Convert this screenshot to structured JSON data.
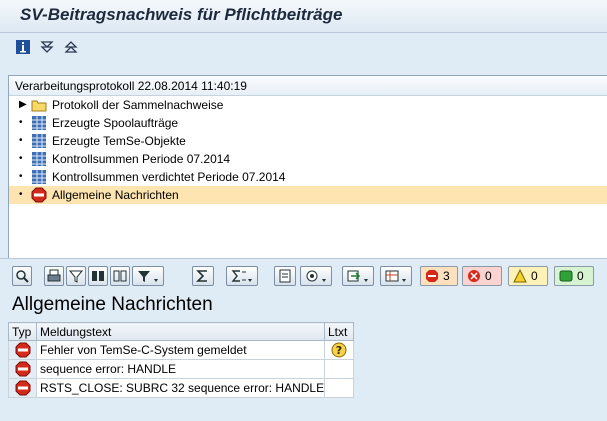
{
  "window": {
    "title": "SV-Beitragsnachweis für Pflichtbeiträge"
  },
  "app_toolbar": {
    "icons": [
      "info-icon",
      "expand-all-icon",
      "collapse-all-icon"
    ]
  },
  "tree": {
    "header": "Verarbeitungsprotokoll 22.08.2014 11:40:19",
    "items": [
      {
        "label": "Protokoll der Sammelnachweise",
        "icon": "folder-icon",
        "expander": "▶"
      },
      {
        "label": "Erzeugte Spoolaufträge",
        "icon": "table-icon",
        "expander": "•"
      },
      {
        "label": "Erzeugte TemSe-Objekte",
        "icon": "table-icon",
        "expander": "•"
      },
      {
        "label": "Kontrollsummen Periode 07.2014",
        "icon": "table-icon",
        "expander": "•"
      },
      {
        "label": "Kontrollsummen verdichtet Periode 07.2014",
        "icon": "table-icon",
        "expander": "•"
      },
      {
        "label": "Allgemeine Nachrichten",
        "icon": "stop-icon",
        "expander": "•",
        "selected": true
      }
    ]
  },
  "alv_toolbar": {
    "counters": {
      "stop": "3",
      "error": "0",
      "warning": "0",
      "success": "0"
    }
  },
  "grid": {
    "title": "Allgemeine Nachrichten",
    "columns": [
      "Typ",
      "Meldungstext",
      "Ltxt"
    ],
    "rows": [
      {
        "type_icon": "stop-icon",
        "text": "Fehler von TemSe-C-System gemeldet",
        "ltxt_icon": "question-icon"
      },
      {
        "type_icon": "stop-icon",
        "text": "sequence error: HANDLE",
        "ltxt_icon": ""
      },
      {
        "type_icon": "stop-icon",
        "text": "RSTS_CLOSE: SUBRC 32 sequence error: HANDLE",
        "ltxt_icon": ""
      }
    ]
  },
  "colors": {
    "background": "#dfebf5",
    "selection": "#fde4b0",
    "stop": "#d42a1c"
  }
}
